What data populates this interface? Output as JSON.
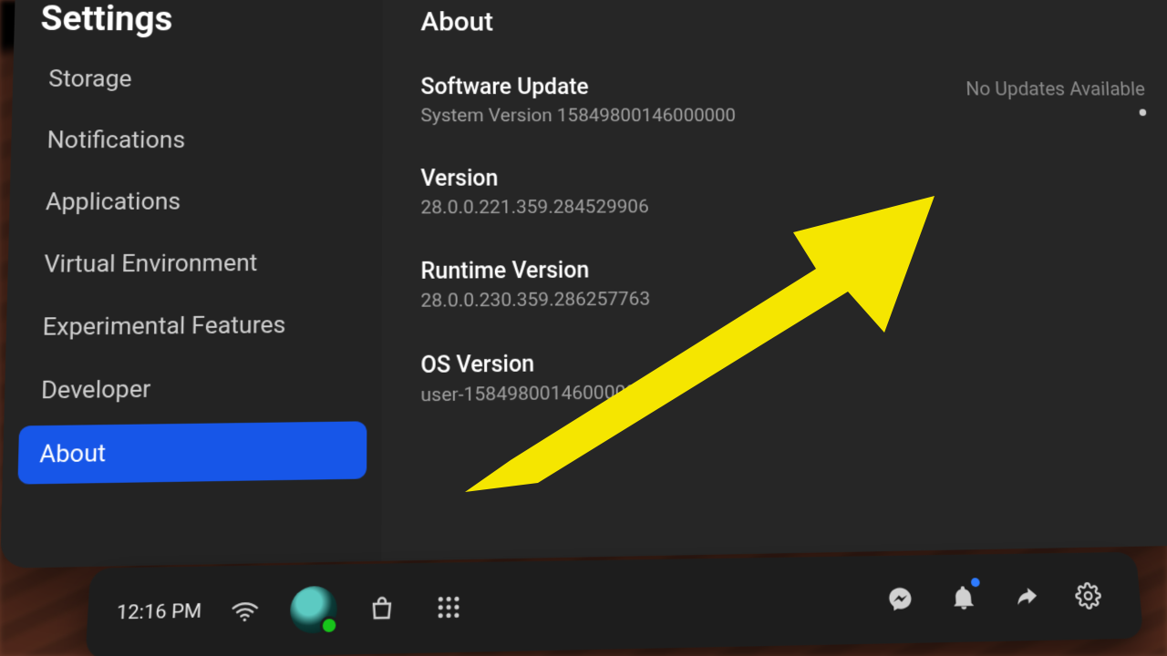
{
  "sidebar": {
    "title": "Settings",
    "items": [
      {
        "label": "Storage"
      },
      {
        "label": "Notifications"
      },
      {
        "label": "Applications"
      },
      {
        "label": "Virtual Environment"
      },
      {
        "label": "Experimental Features"
      },
      {
        "label": "Developer"
      },
      {
        "label": "About"
      }
    ],
    "active_index": 6
  },
  "content": {
    "heading": "About",
    "software_update": {
      "title": "Software Update",
      "subtitle": "System Version 15849800146000000",
      "status": "No Updates Available"
    },
    "version": {
      "title": "Version",
      "value": "28.0.0.221.359.284529906"
    },
    "runtime_version": {
      "title": "Runtime Version",
      "value": "28.0.0.230.359.286257763"
    },
    "os_version": {
      "title": "OS Version",
      "value": "user-15849800146000000"
    }
  },
  "taskbar": {
    "time": "12:16 PM"
  },
  "colors": {
    "accent": "#1756e8",
    "arrow": "#f5e600"
  }
}
